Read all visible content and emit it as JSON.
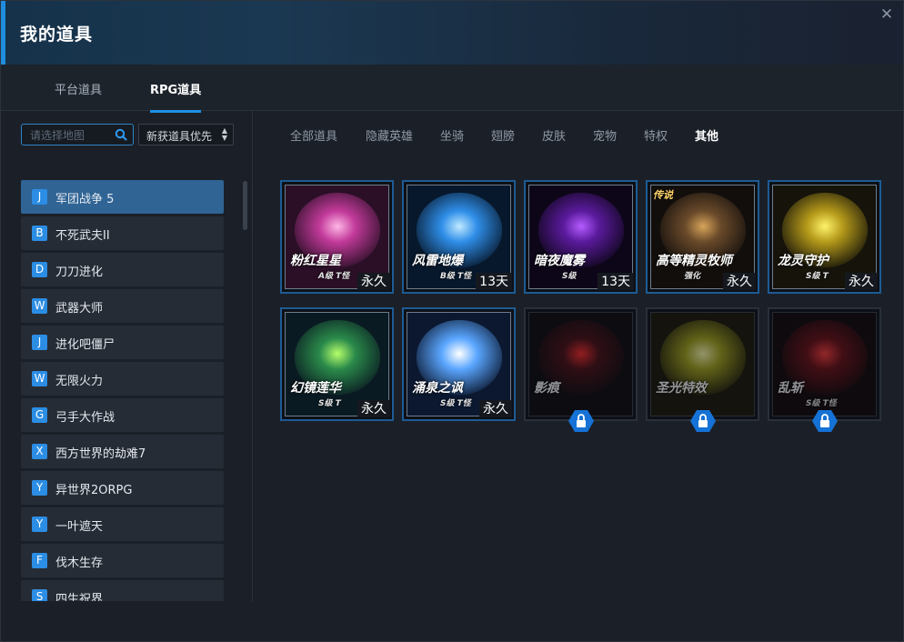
{
  "window": {
    "title": "我的道具",
    "close_glyph": "✕"
  },
  "top_tabs": [
    {
      "label": "平台道具",
      "active": false
    },
    {
      "label": "RPG道具",
      "active": true
    }
  ],
  "search": {
    "placeholder": "请选择地图",
    "icon": "search-icon"
  },
  "sort": {
    "value": "新获道具优先",
    "icon": "sort-arrows-icon"
  },
  "maps": [
    {
      "letter": "J",
      "name": "军团战争 5",
      "active": true
    },
    {
      "letter": "B",
      "name": "不死武夫II"
    },
    {
      "letter": "D",
      "name": "刀刀进化"
    },
    {
      "letter": "W",
      "name": "武器大师"
    },
    {
      "letter": "J",
      "name": "进化吧僵尸"
    },
    {
      "letter": "W",
      "name": "无限火力"
    },
    {
      "letter": "G",
      "name": "弓手大作战"
    },
    {
      "letter": "X",
      "name": "西方世界的劫难7"
    },
    {
      "letter": "Y",
      "name": "异世界2ORPG"
    },
    {
      "letter": "Y",
      "name": "一叶遮天"
    },
    {
      "letter": "F",
      "name": "伐木生存"
    },
    {
      "letter": "S",
      "name": "四生祝界"
    }
  ],
  "categories": [
    {
      "label": "全部道具"
    },
    {
      "label": "隐藏英雄"
    },
    {
      "label": "坐骑"
    },
    {
      "label": "翅膀"
    },
    {
      "label": "皮肤"
    },
    {
      "label": "宠物"
    },
    {
      "label": "特权"
    },
    {
      "label": "其他",
      "active": true
    }
  ],
  "items": [
    {
      "caption": "粉红星星",
      "sub": "A级 T怪",
      "badge": "永久",
      "locked": false,
      "colors": [
        "#ffb6e6",
        "#c23a9a",
        "#2a0f26"
      ]
    },
    {
      "caption": "风雷地爆",
      "sub": "B级 T怪",
      "badge": "13天",
      "locked": false,
      "colors": [
        "#bfe9ff",
        "#2f8ee8",
        "#07182c"
      ]
    },
    {
      "caption": "暗夜魔雾",
      "sub": "S级",
      "badge": "13天",
      "locked": false,
      "colors": [
        "#b45cff",
        "#5a1a9c",
        "#0d0618"
      ]
    },
    {
      "caption": "高等精灵牧师",
      "sub": "强化",
      "badge": "永久",
      "locked": false,
      "corner": "传说",
      "colors": [
        "#d7a45a",
        "#6a4a2a",
        "#120e0c"
      ]
    },
    {
      "caption": "龙灵守护",
      "sub": "S级 T",
      "badge": "永久",
      "locked": false,
      "colors": [
        "#fff36a",
        "#b59a1a",
        "#15130a"
      ]
    },
    {
      "caption": "幻镜莲华",
      "sub": "S级 T",
      "badge": "永久",
      "locked": false,
      "colors": [
        "#b6ff6a",
        "#2a8a4a",
        "#0a1a22"
      ]
    },
    {
      "caption": "涌泉之讽",
      "sub": "S级 T怪",
      "badge": "永久",
      "locked": false,
      "colors": [
        "#ffffff",
        "#5aa6ff",
        "#0b1830"
      ]
    },
    {
      "caption": "影痕",
      "sub": "",
      "badge": "",
      "locked": true,
      "colors": [
        "#ff2a2a",
        "#4a0e14",
        "#0c0a0e"
      ]
    },
    {
      "caption": "圣光特效",
      "sub": "",
      "badge": "",
      "locked": true,
      "colors": [
        "#ffffb0",
        "#a6a61a",
        "#1a1608"
      ]
    },
    {
      "caption": "乱斩",
      "sub": "S级 T怪",
      "badge": "",
      "locked": true,
      "colors": [
        "#ff3a3a",
        "#6a0e14",
        "#100608"
      ]
    }
  ]
}
